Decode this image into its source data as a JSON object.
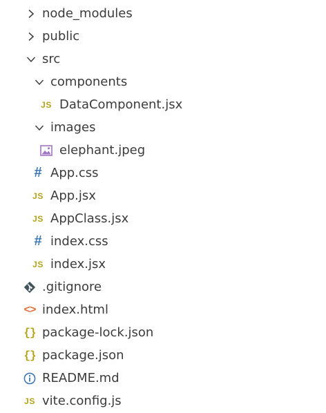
{
  "explorer": {
    "items": [
      {
        "label": "node_modules",
        "kind": "folder",
        "state": "collapsed",
        "depth": 0
      },
      {
        "label": "public",
        "kind": "folder",
        "state": "collapsed",
        "depth": 0
      },
      {
        "label": "src",
        "kind": "folder",
        "state": "expanded",
        "depth": 0
      },
      {
        "label": "components",
        "kind": "folder",
        "state": "expanded",
        "depth": 1
      },
      {
        "label": "DataComponent.jsx",
        "kind": "file",
        "icon": "javascript-icon",
        "icon_text": "JS",
        "depth": 2
      },
      {
        "label": "images",
        "kind": "folder",
        "state": "expanded",
        "depth": 1
      },
      {
        "label": "elephant.jpeg",
        "kind": "file",
        "icon": "image-icon",
        "depth": 2
      },
      {
        "label": "App.css",
        "kind": "file",
        "icon": "css-icon",
        "icon_text": "#",
        "depth": 1
      },
      {
        "label": "App.jsx",
        "kind": "file",
        "icon": "javascript-icon",
        "icon_text": "JS",
        "depth": 1
      },
      {
        "label": "AppClass.jsx",
        "kind": "file",
        "icon": "javascript-icon",
        "icon_text": "JS",
        "depth": 1
      },
      {
        "label": "index.css",
        "kind": "file",
        "icon": "css-icon",
        "icon_text": "#",
        "depth": 1
      },
      {
        "label": "index.jsx",
        "kind": "file",
        "icon": "javascript-icon",
        "icon_text": "JS",
        "depth": 1
      },
      {
        "label": ".gitignore",
        "kind": "file",
        "icon": "git-icon",
        "depth": 0
      },
      {
        "label": "index.html",
        "kind": "file",
        "icon": "html-icon",
        "icon_text": "<>",
        "depth": 0
      },
      {
        "label": "package-lock.json",
        "kind": "file",
        "icon": "json-icon",
        "icon_text": "{}",
        "depth": 0
      },
      {
        "label": "package.json",
        "kind": "file",
        "icon": "json-icon",
        "icon_text": "{}",
        "depth": 0
      },
      {
        "label": "README.md",
        "kind": "file",
        "icon": "info-icon",
        "depth": 0
      },
      {
        "label": "vite.config.js",
        "kind": "file",
        "icon": "javascript-icon",
        "icon_text": "JS",
        "depth": 0
      }
    ]
  },
  "colors": {
    "text": "#3b3b3b",
    "chevron": "#424242",
    "js": "#b5a31a",
    "css": "#3e78b3",
    "html": "#e2703a",
    "json": "#b5a31a",
    "git": "#41535b",
    "info": "#3e78b3",
    "image": "#a074c4"
  }
}
